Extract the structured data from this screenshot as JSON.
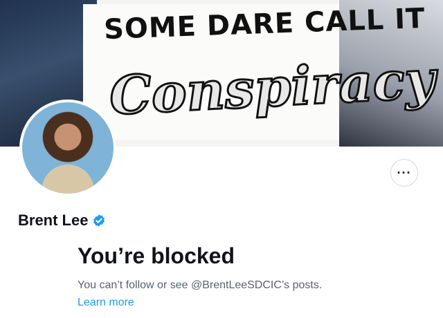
{
  "banner": {
    "text_top": "SOME DARE CALL IT",
    "text_main": "Conspiracy"
  },
  "profile": {
    "name": "Brent Lee",
    "more_icon": "more-horizontal-icon"
  },
  "blocked": {
    "title": "You’re blocked",
    "description": "You can’t follow or see @BrentLeeSDCIC’s posts.",
    "learn_more": "Learn more"
  },
  "colors": {
    "link": "#1d9bf0",
    "verified": "#1d9bf0",
    "secondary_text": "#536471",
    "primary_text": "#0f1419"
  }
}
